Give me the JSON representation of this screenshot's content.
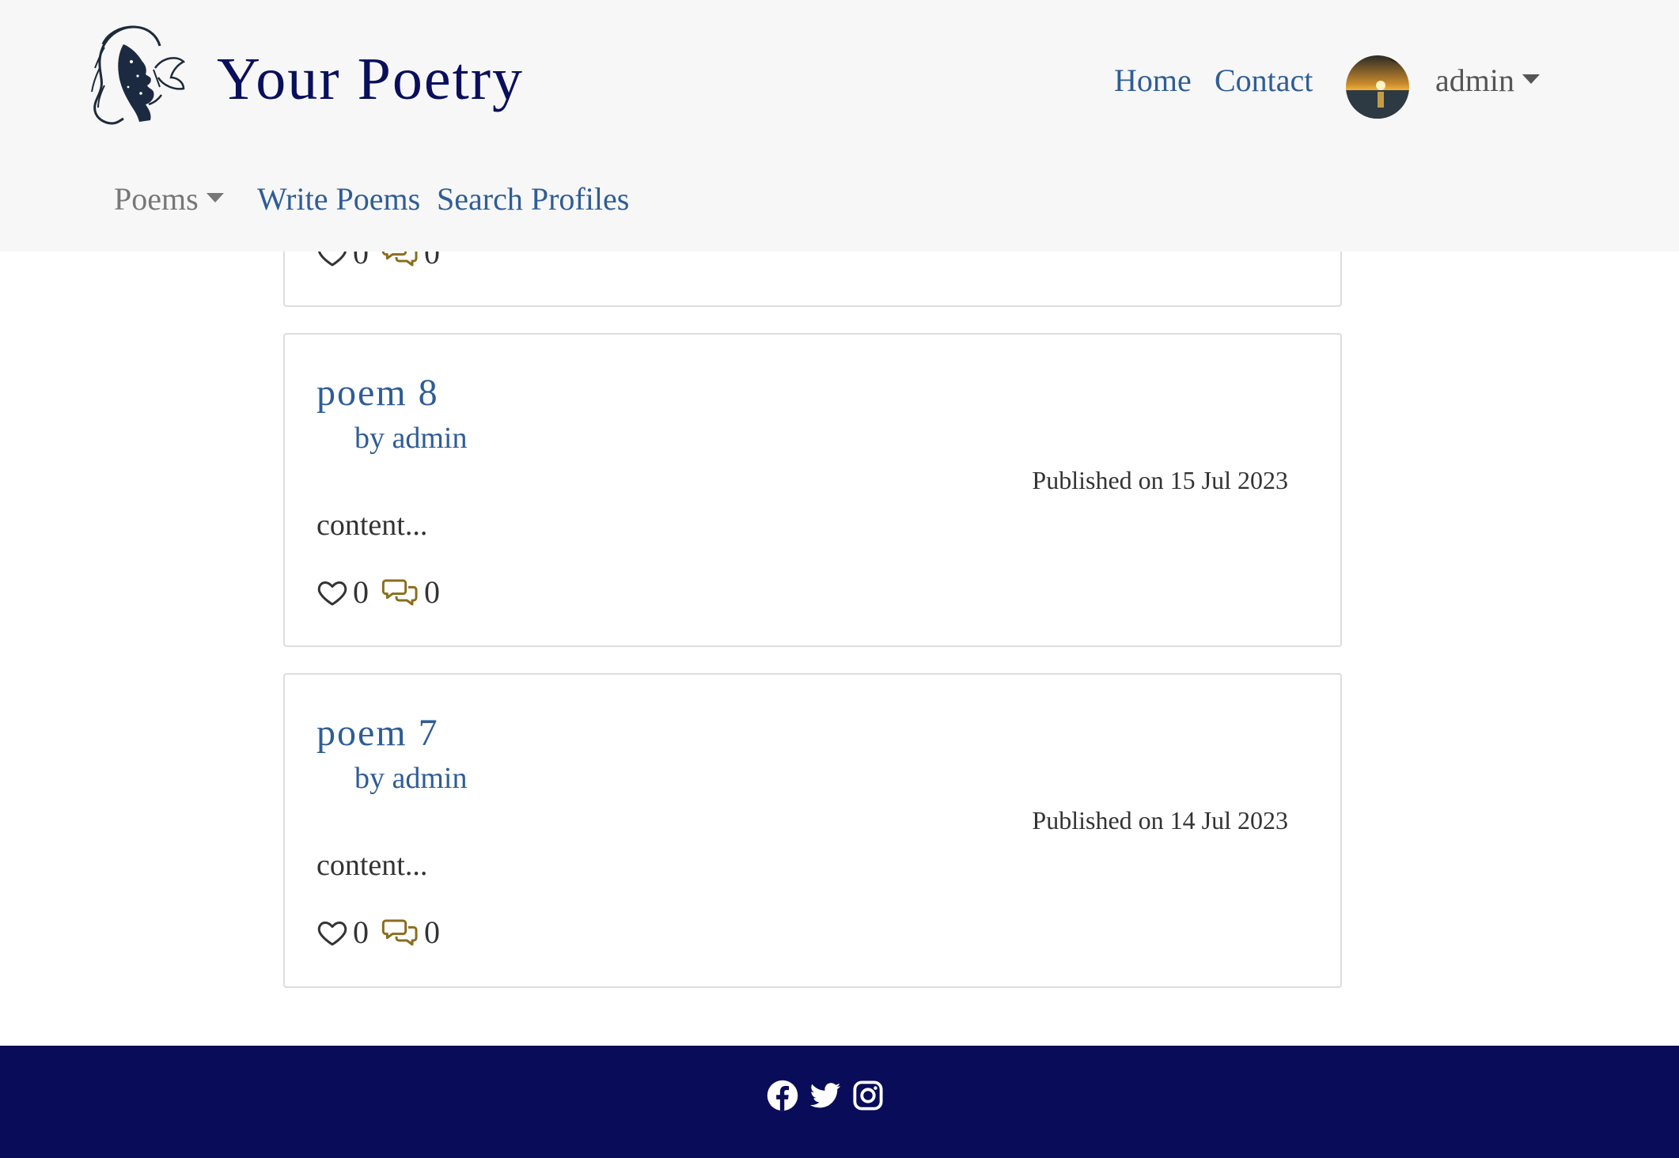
{
  "header": {
    "brand": "Your Poetry",
    "nav": {
      "home": "Home",
      "contact": "Contact"
    },
    "user": {
      "name": "admin"
    },
    "sub_nav": {
      "poems": "Poems",
      "write": "Write Poems",
      "search": "Search Profiles"
    }
  },
  "poems": [
    {
      "likes": "0",
      "comments": "0"
    },
    {
      "title": "poem 8",
      "author": "by admin",
      "published": "Published on 15 Jul 2023",
      "content": "content...",
      "likes": "0",
      "comments": "0"
    },
    {
      "title": "poem 7",
      "author": "by admin",
      "published": "Published on 14 Jul 2023",
      "content": "content...",
      "likes": "0",
      "comments": "0"
    }
  ],
  "footer": {
    "icons": [
      "facebook-icon",
      "twitter-icon",
      "instagram-icon"
    ]
  },
  "colors": {
    "brand": "#0a0f5c",
    "link": "#2f5d96",
    "comment_icon": "#8a6d1f",
    "footer_bg": "#090c58",
    "header_bg": "#f7f7f7"
  }
}
